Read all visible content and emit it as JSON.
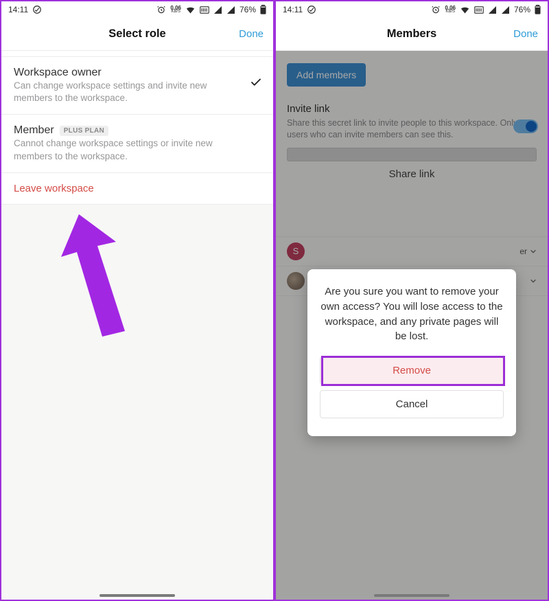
{
  "status": {
    "time": "14:11",
    "kbs_value": "0.06",
    "kbs_unit": "KB/S",
    "battery": "76%"
  },
  "left": {
    "title": "Select role",
    "done": "Done",
    "roles": [
      {
        "title": "Workspace owner",
        "desc": "Can change workspace settings and invite new members to the workspace.",
        "selected": true
      },
      {
        "title": "Member",
        "badge": "PLUS PLAN",
        "desc": "Cannot change workspace settings or invite new members to the workspace.",
        "selected": false
      }
    ],
    "leave": "Leave workspace"
  },
  "right": {
    "title": "Members",
    "done": "Done",
    "add_members": "Add members",
    "invite_link_label": "Invite link",
    "invite_link_desc": "Share this secret link to invite people to this workspace. Only users who can invite members can see this.",
    "share_link": "Share link",
    "members": [
      {
        "avatar_letter": "S",
        "role_suffix": "er"
      },
      {
        "avatar_letter": "",
        "role_suffix": ""
      }
    ],
    "dialog": {
      "text": "Are you sure you want to remove your own access? You will lose access to the workspace, and any private pages will be lost.",
      "remove": "Remove",
      "cancel": "Cancel"
    }
  }
}
